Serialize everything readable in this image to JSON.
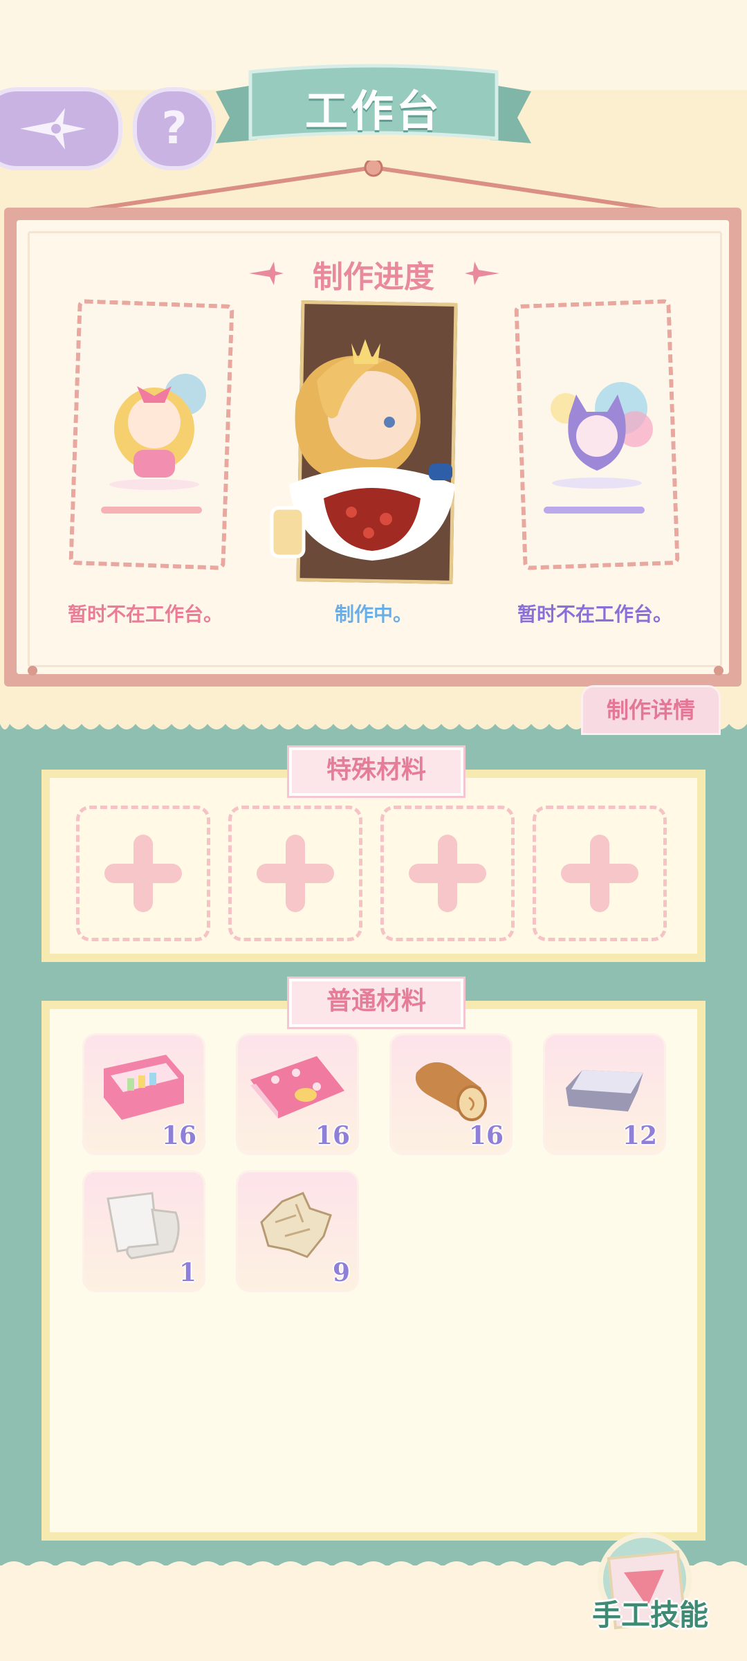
{
  "header": {
    "title": "工作台",
    "back_icon": "shuriken-back-icon",
    "help_label": "?"
  },
  "progress": {
    "title": "制作进度",
    "slots": [
      {
        "status": "暂时不在工作台。",
        "color": "#e97d98"
      },
      {
        "status": "制作中。",
        "color": "#6aaee8"
      },
      {
        "status": "暂时不在工作台。",
        "color": "#8a6fd6"
      }
    ],
    "detail_button": "制作详情"
  },
  "special_materials": {
    "title": "特殊材料",
    "slots": [
      "add-slot-1",
      "add-slot-2",
      "add-slot-3",
      "add-slot-4"
    ]
  },
  "normal_materials": {
    "title": "普通材料",
    "items": [
      {
        "icon": "sewing-box-icon",
        "count": "16"
      },
      {
        "icon": "polka-fabric-icon",
        "count": "16"
      },
      {
        "icon": "wood-log-icon",
        "count": "16"
      },
      {
        "icon": "silver-ingot-icon",
        "count": "12"
      },
      {
        "icon": "white-cloth-icon",
        "count": "1"
      },
      {
        "icon": "fur-pelt-icon",
        "count": "9"
      }
    ]
  },
  "footer": {
    "skill_button": "手工技能"
  },
  "colors": {
    "teal": "#8fbfb1",
    "cream": "#fcefcf",
    "pink": "#e57d98",
    "lavender": "#c9b3e3"
  }
}
